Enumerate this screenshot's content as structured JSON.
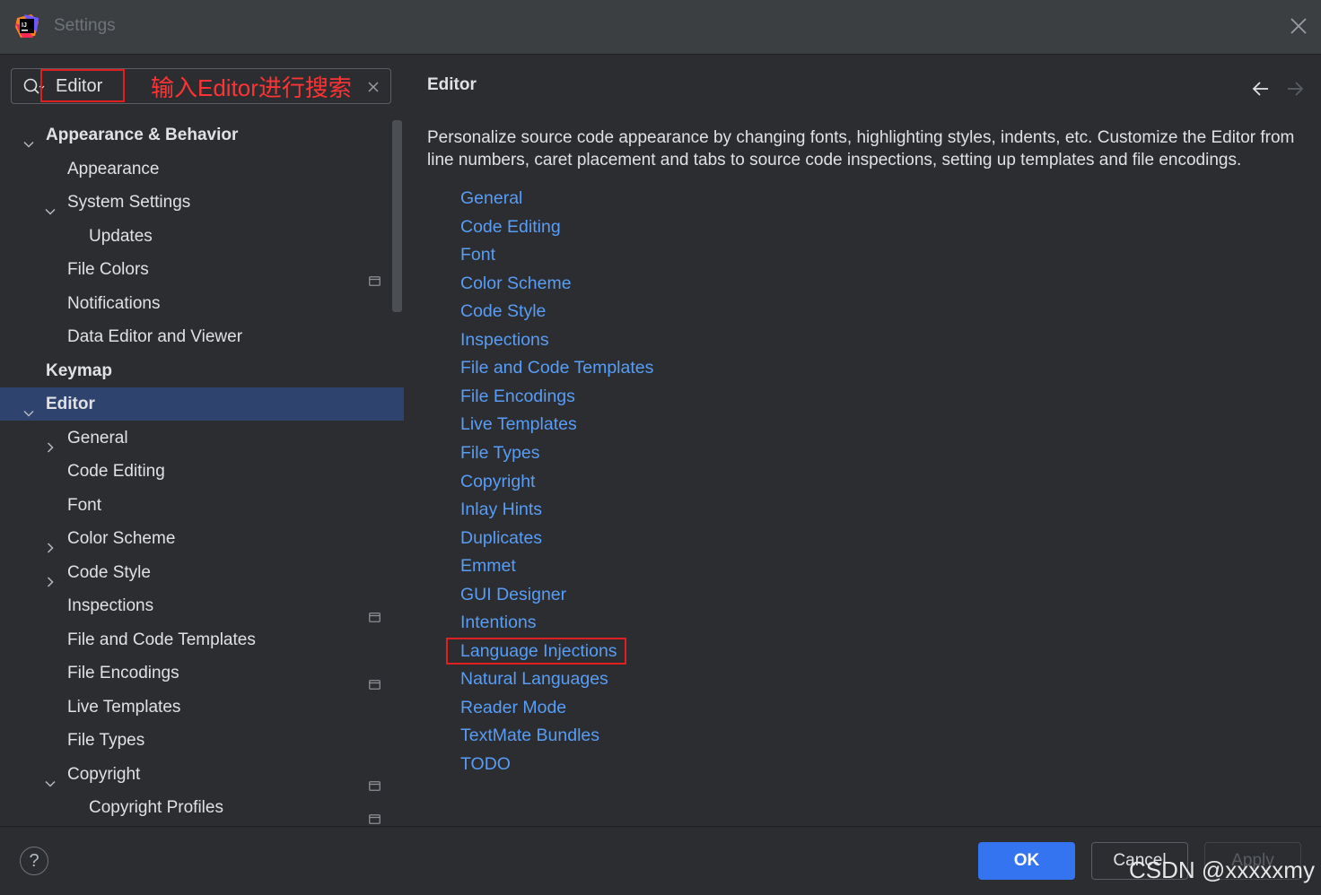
{
  "window": {
    "title": "Settings",
    "icons": [
      "app-icon",
      "close-icon"
    ]
  },
  "search": {
    "value": "Editor",
    "annotation": "输入Editor进行搜索"
  },
  "tree": [
    {
      "label": "Appearance & Behavior",
      "level": 0,
      "expanded": true,
      "bold": true
    },
    {
      "label": "Appearance",
      "level": 1
    },
    {
      "label": "System Settings",
      "level": 1,
      "expanded": true
    },
    {
      "label": "Updates",
      "level": 2
    },
    {
      "label": "File Colors",
      "level": 1,
      "project_icon": true
    },
    {
      "label": "Notifications",
      "level": 1
    },
    {
      "label": "Data Editor and Viewer",
      "level": 1
    },
    {
      "label": "Keymap",
      "level": 0,
      "bold": true
    },
    {
      "label": "Editor",
      "level": 0,
      "expanded": true,
      "bold": true,
      "selected": true
    },
    {
      "label": "General",
      "level": 1,
      "collapsed": true
    },
    {
      "label": "Code Editing",
      "level": 1
    },
    {
      "label": "Font",
      "level": 1
    },
    {
      "label": "Color Scheme",
      "level": 1,
      "collapsed": true
    },
    {
      "label": "Code Style",
      "level": 1,
      "collapsed": true
    },
    {
      "label": "Inspections",
      "level": 1,
      "project_icon": true
    },
    {
      "label": "File and Code Templates",
      "level": 1
    },
    {
      "label": "File Encodings",
      "level": 1,
      "project_icon": true
    },
    {
      "label": "Live Templates",
      "level": 1
    },
    {
      "label": "File Types",
      "level": 1
    },
    {
      "label": "Copyright",
      "level": 1,
      "expanded": true,
      "project_icon": true
    },
    {
      "label": "Copyright Profiles",
      "level": 2,
      "project_icon": true
    }
  ],
  "content": {
    "title": "Editor",
    "description": "Personalize source code appearance by changing fonts, highlighting styles, indents, etc. Customize the Editor from line numbers, caret placement and tabs to source code inspections, setting up templates and file encodings.",
    "links": [
      "General",
      "Code Editing",
      "Font",
      "Color Scheme",
      "Code Style",
      "Inspections",
      "File and Code Templates",
      "File Encodings",
      "Live Templates",
      "File Types",
      "Copyright",
      "Inlay Hints",
      "Duplicates",
      "Emmet",
      "GUI Designer",
      "Intentions",
      "Language Injections",
      "Natural Languages",
      "Reader Mode",
      "TextMate Bundles",
      "TODO"
    ],
    "highlighted_link": "Language Injections"
  },
  "footer": {
    "help": "?",
    "ok": "OK",
    "cancel": "Cancel",
    "apply": "Apply",
    "watermark": "CSDN @xxxxxmy"
  },
  "colors": {
    "accent": "#3574f0",
    "link": "#589df6",
    "selection": "#2e436e",
    "annotation": "#e02020"
  }
}
